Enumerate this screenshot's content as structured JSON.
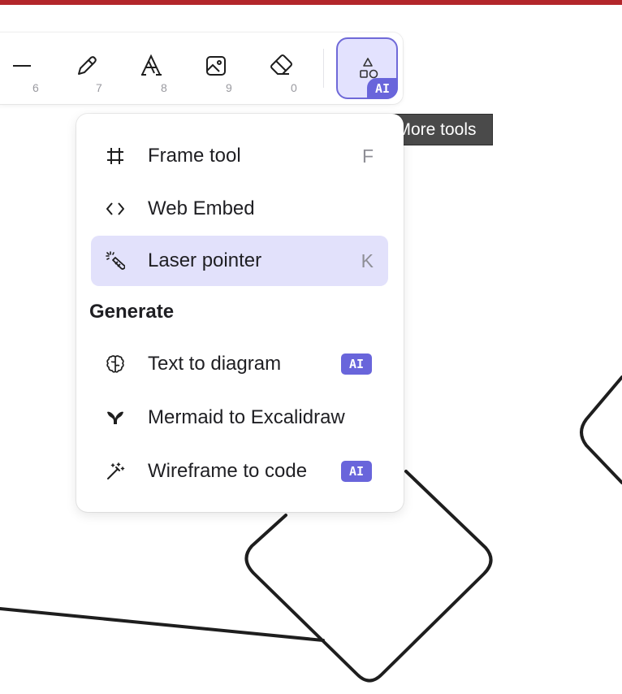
{
  "colors": {
    "accent": "#6965db",
    "active_bg": "#e2e1fb",
    "top_bar": "#b3262b",
    "tooltip_bg": "#4a4a4a"
  },
  "toolbar": {
    "tools": [
      {
        "icon": "line-icon",
        "shortcut": "6"
      },
      {
        "icon": "pencil-icon",
        "shortcut": "7"
      },
      {
        "icon": "text-icon",
        "shortcut": "8"
      },
      {
        "icon": "image-icon",
        "shortcut": "9"
      },
      {
        "icon": "eraser-icon",
        "shortcut": "0"
      }
    ],
    "more_tools": {
      "icon": "shapes-icon",
      "badge": "AI"
    }
  },
  "tooltip": "More tools",
  "menu": {
    "items": [
      {
        "label": "Frame tool",
        "shortcut": "F",
        "icon": "frame-icon"
      },
      {
        "label": "Web Embed",
        "shortcut": "",
        "icon": "code-icon"
      },
      {
        "label": "Laser pointer",
        "shortcut": "K",
        "icon": "laser-pointer-icon",
        "active": true
      }
    ],
    "generate_heading": "Generate",
    "generate_items": [
      {
        "label": "Text to diagram",
        "icon": "brain-icon",
        "badge": "AI"
      },
      {
        "label": "Mermaid to Excalidraw",
        "icon": "mermaid-icon"
      },
      {
        "label": "Wireframe to code",
        "icon": "magic-wand-icon",
        "badge": "AI"
      }
    ]
  }
}
